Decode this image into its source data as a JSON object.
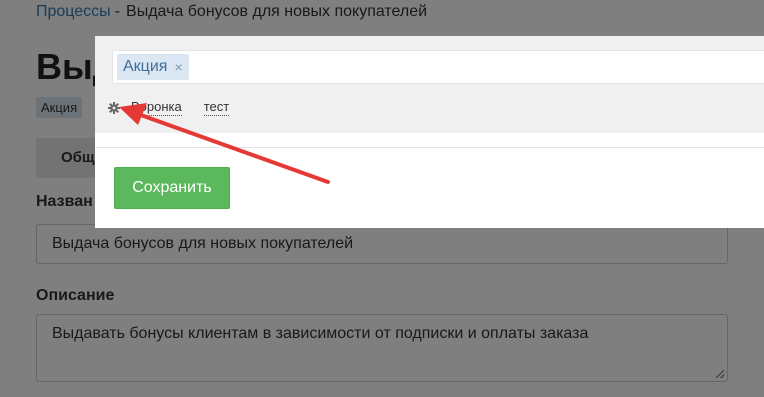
{
  "breadcrumb": {
    "link": "Процессы",
    "separator": "-",
    "current": "Выдача бонусов для новых покупателей"
  },
  "page": {
    "title": "Выд",
    "tag": "Акция",
    "tab": "Общ",
    "name_label": "Назван",
    "name_value": "Выдача бонусов для новых покупателей",
    "description_label": "Описание",
    "description_value": "Выдавать бонусы клиентам в зависимости от подписки и оплаты заказа"
  },
  "modal": {
    "selected_tag": "Акция",
    "remove_symbol": "×",
    "options": [
      "Воронка",
      "тест"
    ],
    "save_label": "Сохранить"
  },
  "colors": {
    "save_button": "#5cb85c",
    "arrow": "#e53935",
    "link": "#337ab7"
  }
}
